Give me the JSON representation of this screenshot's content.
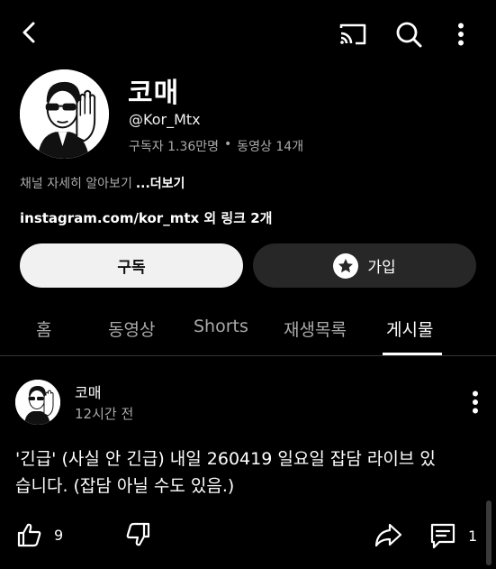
{
  "topbar": {
    "back_icon": "chevron-left-icon",
    "cast_icon": "cast-icon",
    "search_icon": "search-icon",
    "more_icon": "more-vertical-icon"
  },
  "channel": {
    "name": "코매",
    "handle": "@Kor_Mtx",
    "subscribers": "구독자 1.36만명",
    "separator": "•",
    "videos": "동영상 14개",
    "about_text": "채널 자세히 알아보기",
    "about_more": "...더보기",
    "links_text": "instagram.com/kor_mtx 외 링크 2개"
  },
  "buttons": {
    "subscribe_label": "구독",
    "join_label": "가입",
    "join_icon": "star-icon"
  },
  "tabs": [
    {
      "label": "홈"
    },
    {
      "label": "동영상"
    },
    {
      "label": "Shorts"
    },
    {
      "label": "재생목록"
    },
    {
      "label": "게시물"
    }
  ],
  "active_tab": "게시물",
  "post": {
    "author": "코매",
    "time": "12시간 전",
    "text_line1": "'긴급' (사실 안 긴급) 내일 260419 일요일 잡담 라이브 있",
    "text_line2": "습니다. (잡담 아닐 수도 있음.)",
    "likes": "9",
    "comments": "1"
  },
  "colors": {
    "background": "#000000",
    "subscribe_bg": "#f1f1f1",
    "join_bg": "#272727",
    "secondary_text": "#aaaaaa"
  }
}
